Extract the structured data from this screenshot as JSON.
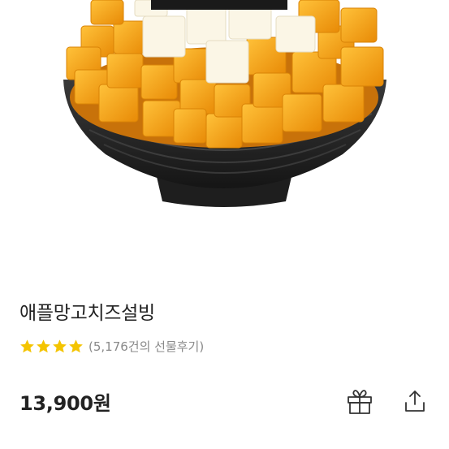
{
  "product": {
    "image_alt": "mango cheese bingsu in black bowl",
    "name": "애플망고치즈설빙",
    "rating_stars": 4,
    "review_text": "(5,176건의 선물후기)",
    "price": "13,900원"
  },
  "actions": {
    "gift_icon": "gift-icon",
    "share_icon": "share-icon"
  },
  "colors": {
    "star": "#f4c400",
    "text": "#222222",
    "muted": "#8a8a8a",
    "mango": "#f5a516",
    "bowl": "#2a2a2a"
  }
}
